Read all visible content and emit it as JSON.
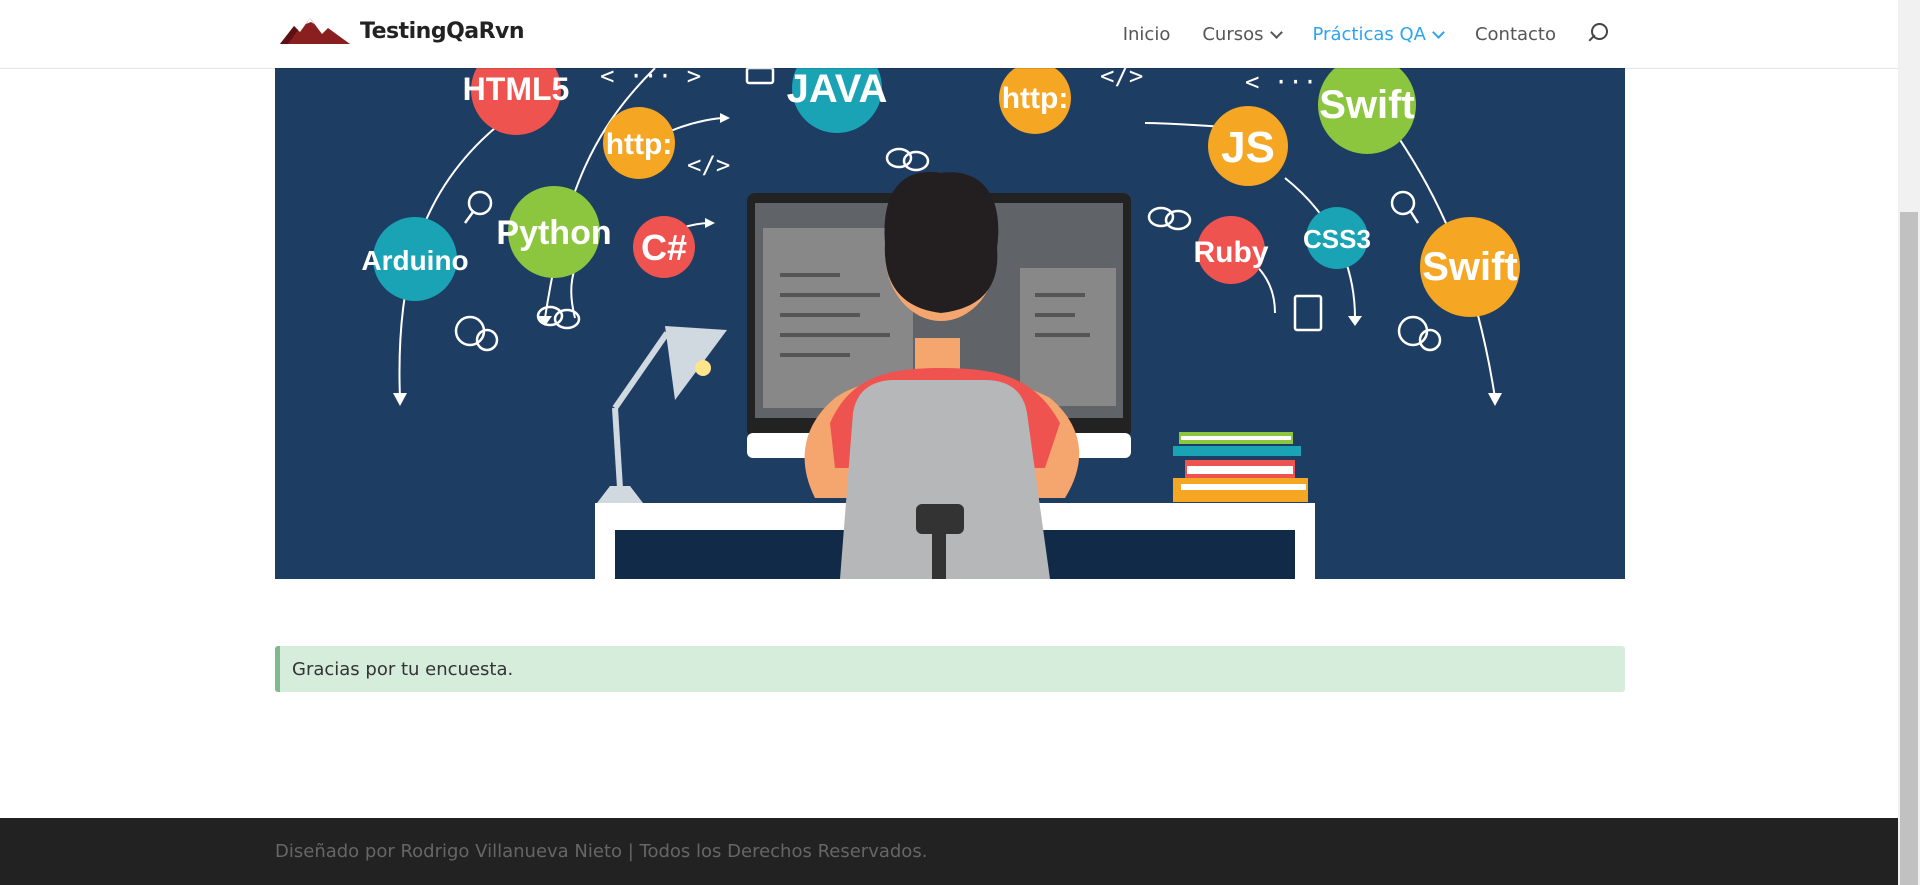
{
  "site": {
    "brand": "TestingQaRvn"
  },
  "nav": {
    "items": [
      {
        "label": "Inicio",
        "dropdown": false,
        "active": false
      },
      {
        "label": "Cursos",
        "dropdown": true,
        "active": false
      },
      {
        "label": "Prácticas QA",
        "dropdown": true,
        "active": true
      },
      {
        "label": "Contacto",
        "dropdown": false,
        "active": false
      }
    ]
  },
  "hero": {
    "badges": [
      "HTML5",
      "JAVA",
      "http:",
      "Swift",
      "http:",
      "JS",
      "Arduino",
      "Python",
      "C#",
      "Ruby",
      "CSS3",
      "Swift"
    ],
    "code_tags": [
      "< ··· >",
      "</>",
      "< / >",
      "< ··· >"
    ]
  },
  "alert": {
    "message": "Gracias por tu encuesta."
  },
  "footer": {
    "text": "Diseñado por Rodrigo Villanueva Nieto | Todos los Derechos Reservados."
  },
  "colors": {
    "accent": "#2ea3f2",
    "hero_bg": "#1e3d63",
    "alert_bg": "#d6eddb",
    "footer_bg": "#222222"
  }
}
